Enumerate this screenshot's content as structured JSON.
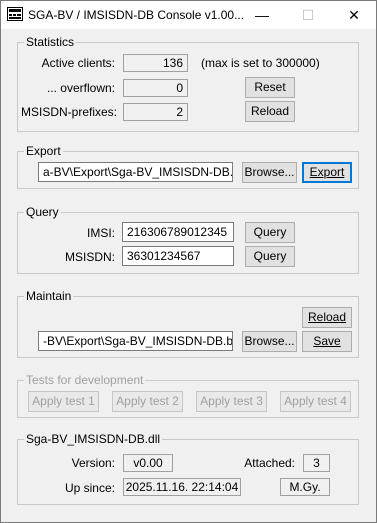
{
  "window": {
    "title": "SGA-BV / IMSISDN-DB Console  v1.00...",
    "minimize": "—",
    "maximize": "☐",
    "close": "✕"
  },
  "statistics": {
    "title": "Statistics",
    "active_clients_label": "Active clients:",
    "active_clients_value": "136",
    "max_note": "(max is set to 300000)",
    "overflown_label": "... overflown:",
    "overflown_value": "0",
    "reset_button": "Reset",
    "prefixes_label": "MSISDN-prefixes:",
    "prefixes_value": "2",
    "reload_button": "Reload"
  },
  "export": {
    "title": "Export",
    "path": "a-BV\\Export\\Sga-BV_IMSISDN-DB.txt",
    "browse_button": "Browse...",
    "export_button": "Export"
  },
  "query": {
    "title": "Query",
    "imsi_label": "IMSI:",
    "imsi_value": "216306789012345",
    "imsi_query_button": "Query",
    "msisdn_label": "MSISDN:",
    "msisdn_value": "36301234567",
    "msisdn_query_button": "Query"
  },
  "maintain": {
    "title": "Maintain",
    "reload_button": "Reload",
    "path": "-BV\\Export\\Sga-BV_IMSISDN-DB.bin",
    "browse_button": "Browse...",
    "save_button": "Save"
  },
  "tests": {
    "title": "Tests for development",
    "buttons": [
      "Apply test 1",
      "Apply test 2",
      "Apply test 3",
      "Apply test 4"
    ]
  },
  "dll": {
    "title": "Sga-BV_IMSISDN-DB.dll",
    "version_label": "Version:",
    "version_value": "v0.00",
    "attached_label": "Attached:",
    "attached_value": "3",
    "upsince_label": "Up since:",
    "upsince_value": "2025.11.16. 22:14:04",
    "author_value": "M.Gy."
  }
}
